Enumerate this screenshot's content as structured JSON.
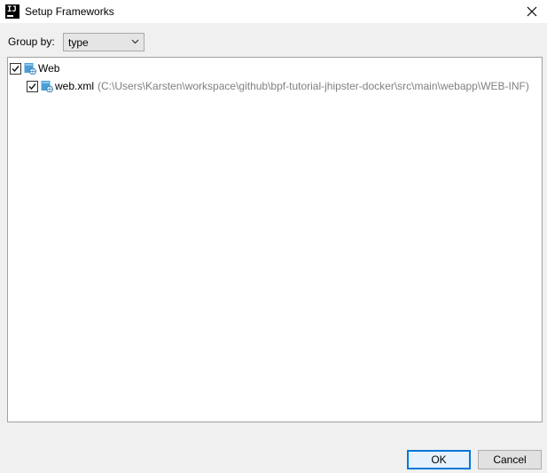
{
  "window": {
    "title": "Setup Frameworks",
    "app_icon_text": "IJ",
    "close_icon": "close-icon"
  },
  "group_by": {
    "label": "Group by:",
    "selected": "type",
    "icon": "chevron-down-icon"
  },
  "tree": {
    "items": [
      {
        "label": "Web",
        "checked": true,
        "icon": "web-folder-icon"
      },
      {
        "label": "web.xml",
        "path": "(C:\\Users\\Karsten\\workspace\\github\\bpf-tutorial-jhipster-docker\\src\\main\\webapp\\WEB-INF)",
        "checked": true,
        "icon": "web-xml-icon"
      }
    ]
  },
  "buttons": {
    "ok": "OK",
    "cancel": "Cancel"
  },
  "colors": {
    "dialog_bg": "#f0f0f0",
    "panel_bg": "#ffffff",
    "default_button_border": "#0078d7",
    "path_text": "#808080",
    "web_icon": "#4a9fd6"
  }
}
